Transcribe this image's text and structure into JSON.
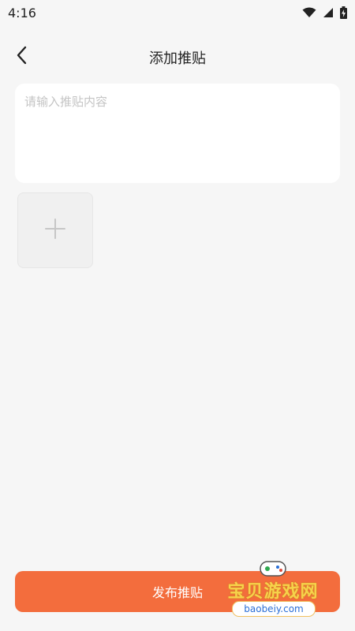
{
  "status_bar": {
    "time": "4:16",
    "icons": [
      "wifi-icon",
      "cellular-signal-icon",
      "battery-charging-icon"
    ]
  },
  "nav": {
    "title": "添加推贴",
    "back_icon": "chevron-left-icon"
  },
  "post_input": {
    "value": "",
    "placeholder": "请输入推贴内容"
  },
  "image_picker": {
    "icon": "plus-icon"
  },
  "publish": {
    "label": "发布推贴",
    "color": "#f36d3d"
  },
  "watermark": {
    "text": "宝贝游戏网",
    "domain": "baobeiy.com",
    "icon": "gamepad-icon"
  }
}
